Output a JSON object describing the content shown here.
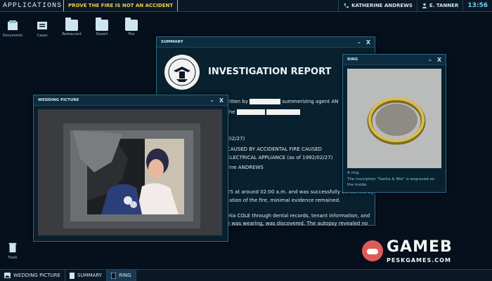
{
  "topbar": {
    "applications": "APPLICATIONS",
    "objective": "Prove the fire is not an accident",
    "contact": "KATHERINE ANDREWS",
    "user": "E. TANNER",
    "clock": "13:56"
  },
  "desktop": {
    "icons": [
      "Documents",
      "Cases",
      "Restaurant",
      "Desert",
      "Fire"
    ],
    "trash": "Trash"
  },
  "summary": {
    "title": "SUMMARY",
    "heading": "INVESTIGATION REPORT",
    "lines": [
      "ritten by",
      "summerizing agent AN",
      "the",
      "",
      "/02/27)",
      "CAUSED BY ACCIDENTAL FIRE CAUSED",
      "ELECTRICAL APPLIANCE (as of 1992/02/27)",
      "rine ANDREWS",
      "25 at around 02:00 a.m. and was successfully contained by",
      "ration of the fire, minimal evidence remained.",
      "Mia COLE through dental records, tenant information, and",
      "e was wearing, was discovered. The autopsy revealed no"
    ]
  },
  "wedding": {
    "title": "WEDDING PICTURE"
  },
  "ring": {
    "title": "RING",
    "caption1": "A ring.",
    "caption2": "The inscription \"Sacha & Mia\" is engraved on the inside."
  },
  "taskbar": {
    "items": [
      "WEDDING PICTURE",
      "SUMMARY",
      "RING"
    ]
  },
  "watermark": {
    "brand": "GAMEB",
    "url": "PESKGAMES.COM"
  },
  "win_controls": {
    "min": "–",
    "close": "X"
  }
}
